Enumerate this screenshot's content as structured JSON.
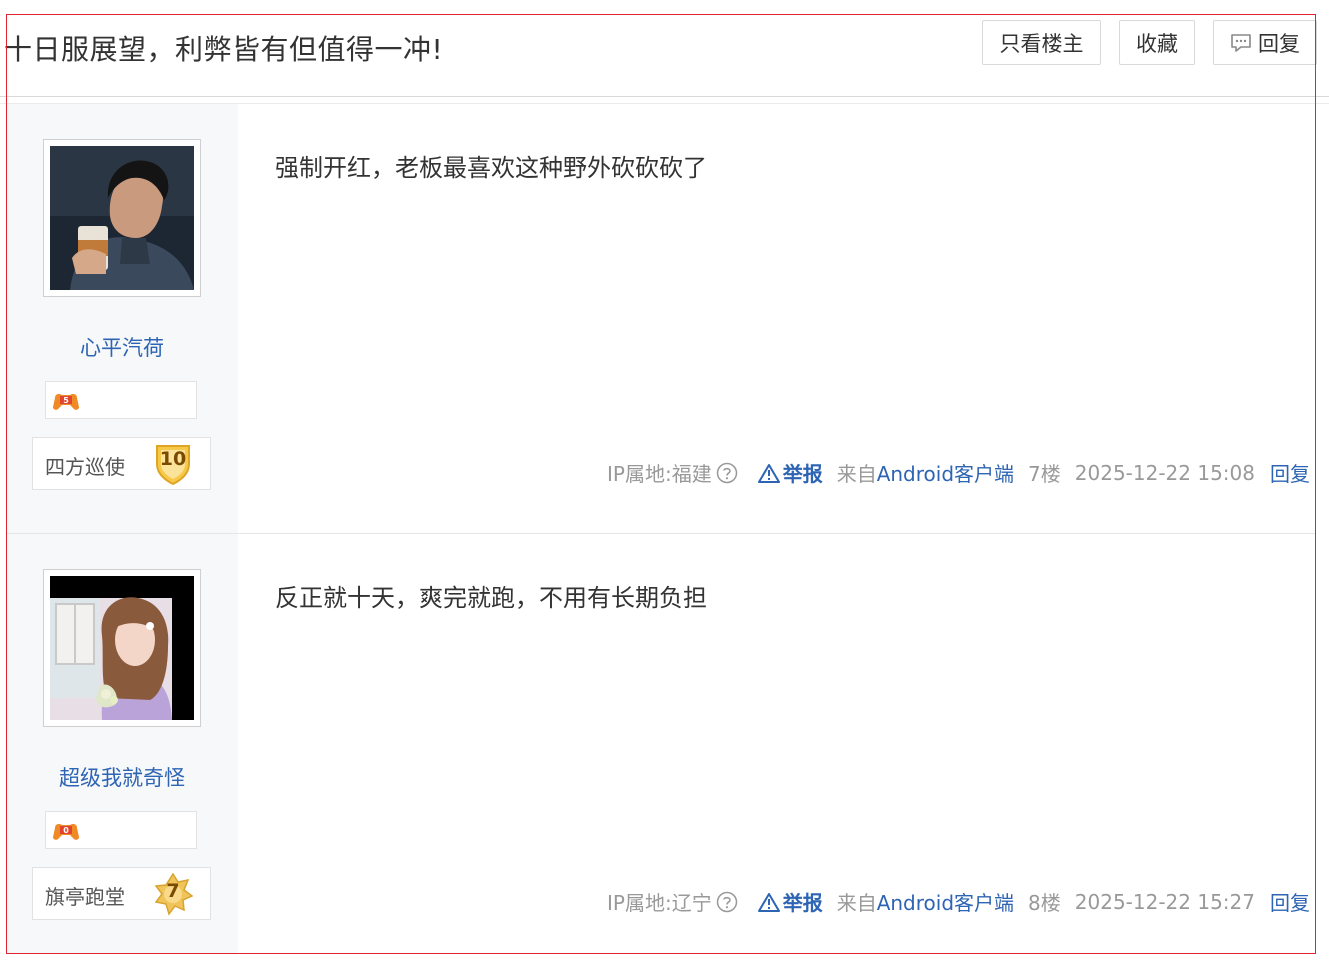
{
  "thread": {
    "title": "十日服展望，利弊皆有但值得一冲!",
    "buttons": {
      "only_op": "只看楼主",
      "favorite": "收藏",
      "reply": "回复"
    }
  },
  "posts": [
    {
      "user": {
        "name": "心平汽荷",
        "rank_title": "四方巡使",
        "level": "10"
      },
      "content": "强制开红，老板最喜欢这种野外砍砍砍了",
      "meta": {
        "ip": "IP属地:福建",
        "report": "举报",
        "source_prefix": "来自",
        "source_app": "Android客户端",
        "floor": "7楼",
        "time": "2025-12-22 15:08",
        "reply": "回复"
      }
    },
    {
      "user": {
        "name": "超级我就奇怪",
        "rank_title": "旗亭跑堂",
        "level": "7"
      },
      "content": "反正就十天，爽完就跑，不用有长期负担",
      "meta": {
        "ip": "IP属地:辽宁",
        "report": "举报",
        "source_prefix": "来自",
        "source_app": "Android客户端",
        "floor": "8楼",
        "time": "2025-12-22 15:27",
        "reply": "回复"
      }
    }
  ],
  "colors": {
    "link": "#2d64b3",
    "meta": "#999999",
    "frame": "#e0242e",
    "sidebar": "#f7f8fa"
  },
  "icons": [
    "comment-icon",
    "question-icon",
    "warning-icon",
    "game-badge-icon",
    "level-shield-icon",
    "level-star-icon"
  ]
}
